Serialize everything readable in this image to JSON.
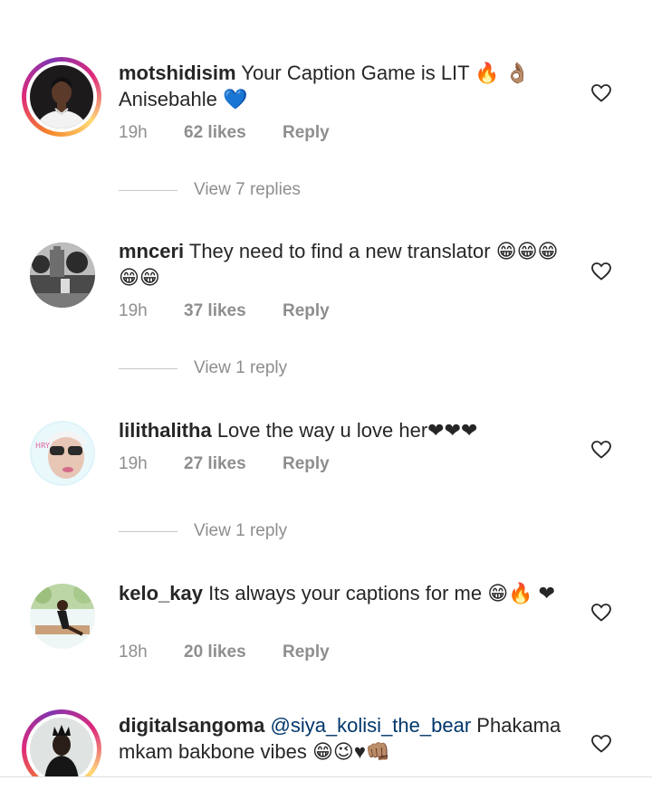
{
  "comments": [
    {
      "username": "motshidisim",
      "text": "Your Caption Game is LIT 🔥 👌🏽 Anisebahle 💙",
      "time": "19h",
      "likes": "62 likes",
      "reply": "Reply",
      "view_replies": "View 7 replies",
      "story_ring": true
    },
    {
      "username": "mnceri",
      "text": "They need to find a new translator 😁😁😁😁😁",
      "time": "19h",
      "likes": "37 likes",
      "reply": "Reply",
      "view_replies": "View 1 reply",
      "story_ring": false
    },
    {
      "username": "lilithalitha",
      "text": "Love the way u love her❤❤❤",
      "time": "19h",
      "likes": "27 likes",
      "reply": "Reply",
      "view_replies": "View 1 reply",
      "story_ring": false
    },
    {
      "username": "kelo_kay",
      "text": "Its always your captions for me 😁🔥 ❤",
      "time": "18h",
      "likes": "20 likes",
      "reply": "Reply",
      "view_replies": "",
      "story_ring": false
    },
    {
      "username": "digitalsangoma",
      "mention": "@siya_kolisi_the_bear",
      "text": "Phakama mkam bakbone vibes 😁😉♥👊🏽",
      "time": "",
      "likes": "",
      "reply": "",
      "view_replies": "",
      "story_ring": true
    }
  ],
  "icons": {
    "like": "heart-outline-icon"
  },
  "colors": {
    "username": "#262626",
    "meta": "#8e8e8e",
    "mention": "#00376b",
    "ring_start": "#f58529",
    "ring_end": "#8134af"
  }
}
